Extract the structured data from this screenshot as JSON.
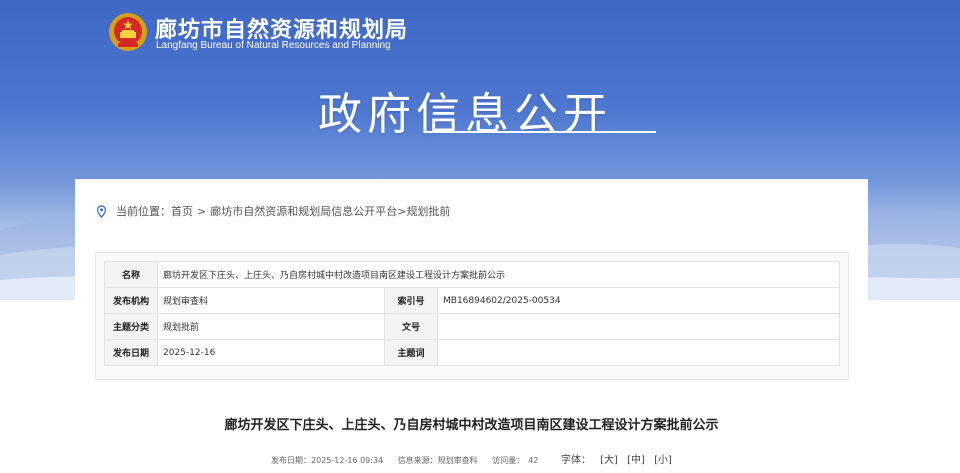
{
  "header": {
    "site_title": "廊坊市自然资源和规划局",
    "site_subtitle": "Langfang Bureau of Natural Resources and Planning",
    "page_title": "政府信息公开",
    "emblem_icon": "national-emblem-icon"
  },
  "breadcrumb": {
    "prefix": "当前位置：",
    "home": "首页",
    "platform": "廊坊市自然资源和规划局信息公开平台",
    "section": "规划批前",
    "sep1": ">",
    "sep2": ">"
  },
  "meta": {
    "name_label": "名称",
    "name_value": "廊坊开发区下庄头、上庄头、乃自房村城中村改造项目南区建设工程设计方案批前公示",
    "publisher_label": "发布机构",
    "publisher_value": "规划审查科",
    "index_label": "索引号",
    "index_value": "MB16894602/2025-00534",
    "category_label": "主题分类",
    "category_value": "规划批前",
    "docno_label": "文号",
    "docno_value": "",
    "date_label": "发布日期",
    "date_value": "2025-12-16",
    "keyword_label": "主题词",
    "keyword_value": ""
  },
  "article": {
    "title": "廊坊开发区下庄头、上庄头、乃自房村城中村改造项目南区建设工程设计方案批前公示",
    "publish_time": "发布日期：2025-12-16 09:34",
    "source": "信息来源：规划审查科",
    "visits_label": "访问量：",
    "visits_value": "42",
    "font_label": "字体：",
    "font_large": "[大]",
    "font_medium": "[中]",
    "font_small": "[小]"
  },
  "colors": {
    "banner_top": "#3f67c5",
    "banner_bottom": "#eef2f9",
    "text_dark": "#222222"
  }
}
